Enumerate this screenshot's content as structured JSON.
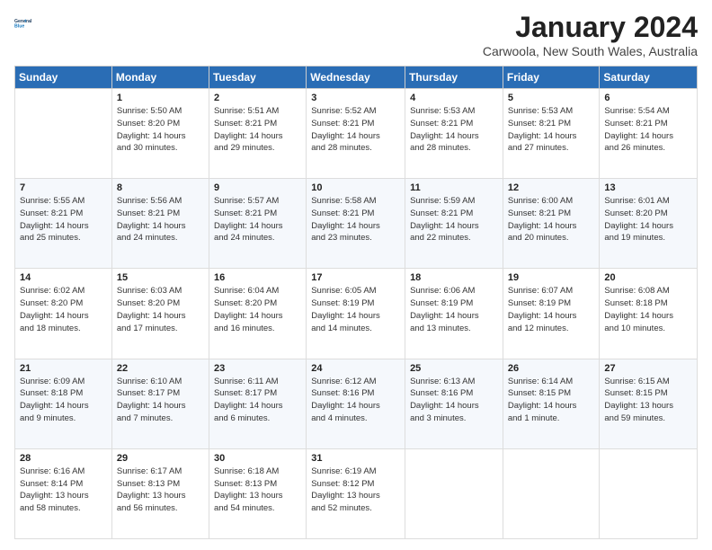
{
  "logo": {
    "line1": "General",
    "line2": "Blue"
  },
  "title": "January 2024",
  "location": "Carwoola, New South Wales, Australia",
  "weekdays": [
    "Sunday",
    "Monday",
    "Tuesday",
    "Wednesday",
    "Thursday",
    "Friday",
    "Saturday"
  ],
  "weeks": [
    [
      {
        "day": "",
        "info": ""
      },
      {
        "day": "1",
        "info": "Sunrise: 5:50 AM\nSunset: 8:20 PM\nDaylight: 14 hours\nand 30 minutes."
      },
      {
        "day": "2",
        "info": "Sunrise: 5:51 AM\nSunset: 8:21 PM\nDaylight: 14 hours\nand 29 minutes."
      },
      {
        "day": "3",
        "info": "Sunrise: 5:52 AM\nSunset: 8:21 PM\nDaylight: 14 hours\nand 28 minutes."
      },
      {
        "day": "4",
        "info": "Sunrise: 5:53 AM\nSunset: 8:21 PM\nDaylight: 14 hours\nand 28 minutes."
      },
      {
        "day": "5",
        "info": "Sunrise: 5:53 AM\nSunset: 8:21 PM\nDaylight: 14 hours\nand 27 minutes."
      },
      {
        "day": "6",
        "info": "Sunrise: 5:54 AM\nSunset: 8:21 PM\nDaylight: 14 hours\nand 26 minutes."
      }
    ],
    [
      {
        "day": "7",
        "info": "Sunrise: 5:55 AM\nSunset: 8:21 PM\nDaylight: 14 hours\nand 25 minutes."
      },
      {
        "day": "8",
        "info": "Sunrise: 5:56 AM\nSunset: 8:21 PM\nDaylight: 14 hours\nand 24 minutes."
      },
      {
        "day": "9",
        "info": "Sunrise: 5:57 AM\nSunset: 8:21 PM\nDaylight: 14 hours\nand 24 minutes."
      },
      {
        "day": "10",
        "info": "Sunrise: 5:58 AM\nSunset: 8:21 PM\nDaylight: 14 hours\nand 23 minutes."
      },
      {
        "day": "11",
        "info": "Sunrise: 5:59 AM\nSunset: 8:21 PM\nDaylight: 14 hours\nand 22 minutes."
      },
      {
        "day": "12",
        "info": "Sunrise: 6:00 AM\nSunset: 8:21 PM\nDaylight: 14 hours\nand 20 minutes."
      },
      {
        "day": "13",
        "info": "Sunrise: 6:01 AM\nSunset: 8:20 PM\nDaylight: 14 hours\nand 19 minutes."
      }
    ],
    [
      {
        "day": "14",
        "info": "Sunrise: 6:02 AM\nSunset: 8:20 PM\nDaylight: 14 hours\nand 18 minutes."
      },
      {
        "day": "15",
        "info": "Sunrise: 6:03 AM\nSunset: 8:20 PM\nDaylight: 14 hours\nand 17 minutes."
      },
      {
        "day": "16",
        "info": "Sunrise: 6:04 AM\nSunset: 8:20 PM\nDaylight: 14 hours\nand 16 minutes."
      },
      {
        "day": "17",
        "info": "Sunrise: 6:05 AM\nSunset: 8:19 PM\nDaylight: 14 hours\nand 14 minutes."
      },
      {
        "day": "18",
        "info": "Sunrise: 6:06 AM\nSunset: 8:19 PM\nDaylight: 14 hours\nand 13 minutes."
      },
      {
        "day": "19",
        "info": "Sunrise: 6:07 AM\nSunset: 8:19 PM\nDaylight: 14 hours\nand 12 minutes."
      },
      {
        "day": "20",
        "info": "Sunrise: 6:08 AM\nSunset: 8:18 PM\nDaylight: 14 hours\nand 10 minutes."
      }
    ],
    [
      {
        "day": "21",
        "info": "Sunrise: 6:09 AM\nSunset: 8:18 PM\nDaylight: 14 hours\nand 9 minutes."
      },
      {
        "day": "22",
        "info": "Sunrise: 6:10 AM\nSunset: 8:17 PM\nDaylight: 14 hours\nand 7 minutes."
      },
      {
        "day": "23",
        "info": "Sunrise: 6:11 AM\nSunset: 8:17 PM\nDaylight: 14 hours\nand 6 minutes."
      },
      {
        "day": "24",
        "info": "Sunrise: 6:12 AM\nSunset: 8:16 PM\nDaylight: 14 hours\nand 4 minutes."
      },
      {
        "day": "25",
        "info": "Sunrise: 6:13 AM\nSunset: 8:16 PM\nDaylight: 14 hours\nand 3 minutes."
      },
      {
        "day": "26",
        "info": "Sunrise: 6:14 AM\nSunset: 8:15 PM\nDaylight: 14 hours\nand 1 minute."
      },
      {
        "day": "27",
        "info": "Sunrise: 6:15 AM\nSunset: 8:15 PM\nDaylight: 13 hours\nand 59 minutes."
      }
    ],
    [
      {
        "day": "28",
        "info": "Sunrise: 6:16 AM\nSunset: 8:14 PM\nDaylight: 13 hours\nand 58 minutes."
      },
      {
        "day": "29",
        "info": "Sunrise: 6:17 AM\nSunset: 8:13 PM\nDaylight: 13 hours\nand 56 minutes."
      },
      {
        "day": "30",
        "info": "Sunrise: 6:18 AM\nSunset: 8:13 PM\nDaylight: 13 hours\nand 54 minutes."
      },
      {
        "day": "31",
        "info": "Sunrise: 6:19 AM\nSunset: 8:12 PM\nDaylight: 13 hours\nand 52 minutes."
      },
      {
        "day": "",
        "info": ""
      },
      {
        "day": "",
        "info": ""
      },
      {
        "day": "",
        "info": ""
      }
    ]
  ]
}
